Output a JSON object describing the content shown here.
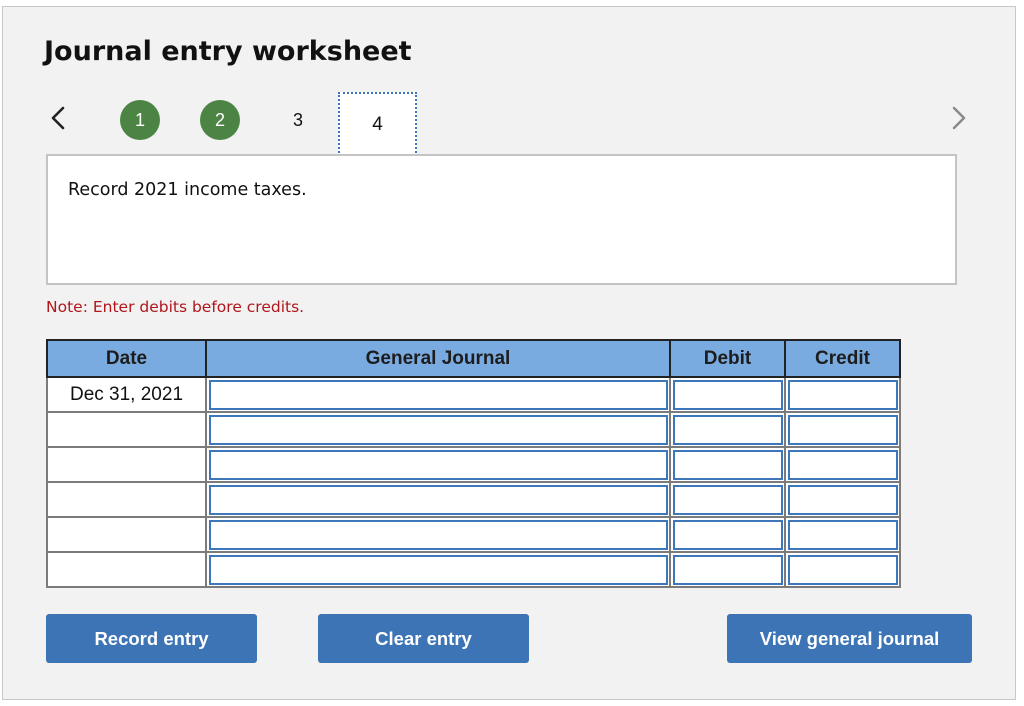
{
  "header": {
    "title": "Journal entry worksheet"
  },
  "navigation": {
    "prev_icon": "chevron-left-icon",
    "next_icon": "chevron-right-icon",
    "steps": [
      {
        "label": "1",
        "status": "completed"
      },
      {
        "label": "2",
        "status": "completed"
      },
      {
        "label": "3",
        "status": "pending"
      },
      {
        "label": "4",
        "status": "current"
      }
    ]
  },
  "prompt": {
    "text": "Record 2021 income taxes."
  },
  "note": {
    "text": "Note: Enter debits before credits."
  },
  "table": {
    "columns": [
      "Date",
      "General Journal",
      "Debit",
      "Credit"
    ],
    "rows": [
      {
        "date": "Dec 31, 2021",
        "account": "",
        "debit": "",
        "credit": ""
      },
      {
        "date": "",
        "account": "",
        "debit": "",
        "credit": ""
      },
      {
        "date": "",
        "account": "",
        "debit": "",
        "credit": ""
      },
      {
        "date": "",
        "account": "",
        "debit": "",
        "credit": ""
      },
      {
        "date": "",
        "account": "",
        "debit": "",
        "credit": ""
      },
      {
        "date": "",
        "account": "",
        "debit": "",
        "credit": ""
      }
    ]
  },
  "buttons": {
    "record": "Record entry",
    "clear": "Clear entry",
    "view": "View general journal"
  },
  "colors": {
    "step_completed": "#4b8443",
    "header_bg": "#7aabe0",
    "button_bg": "#3d74b5",
    "note_text": "#b0161c",
    "input_border": "#3e76ba"
  }
}
